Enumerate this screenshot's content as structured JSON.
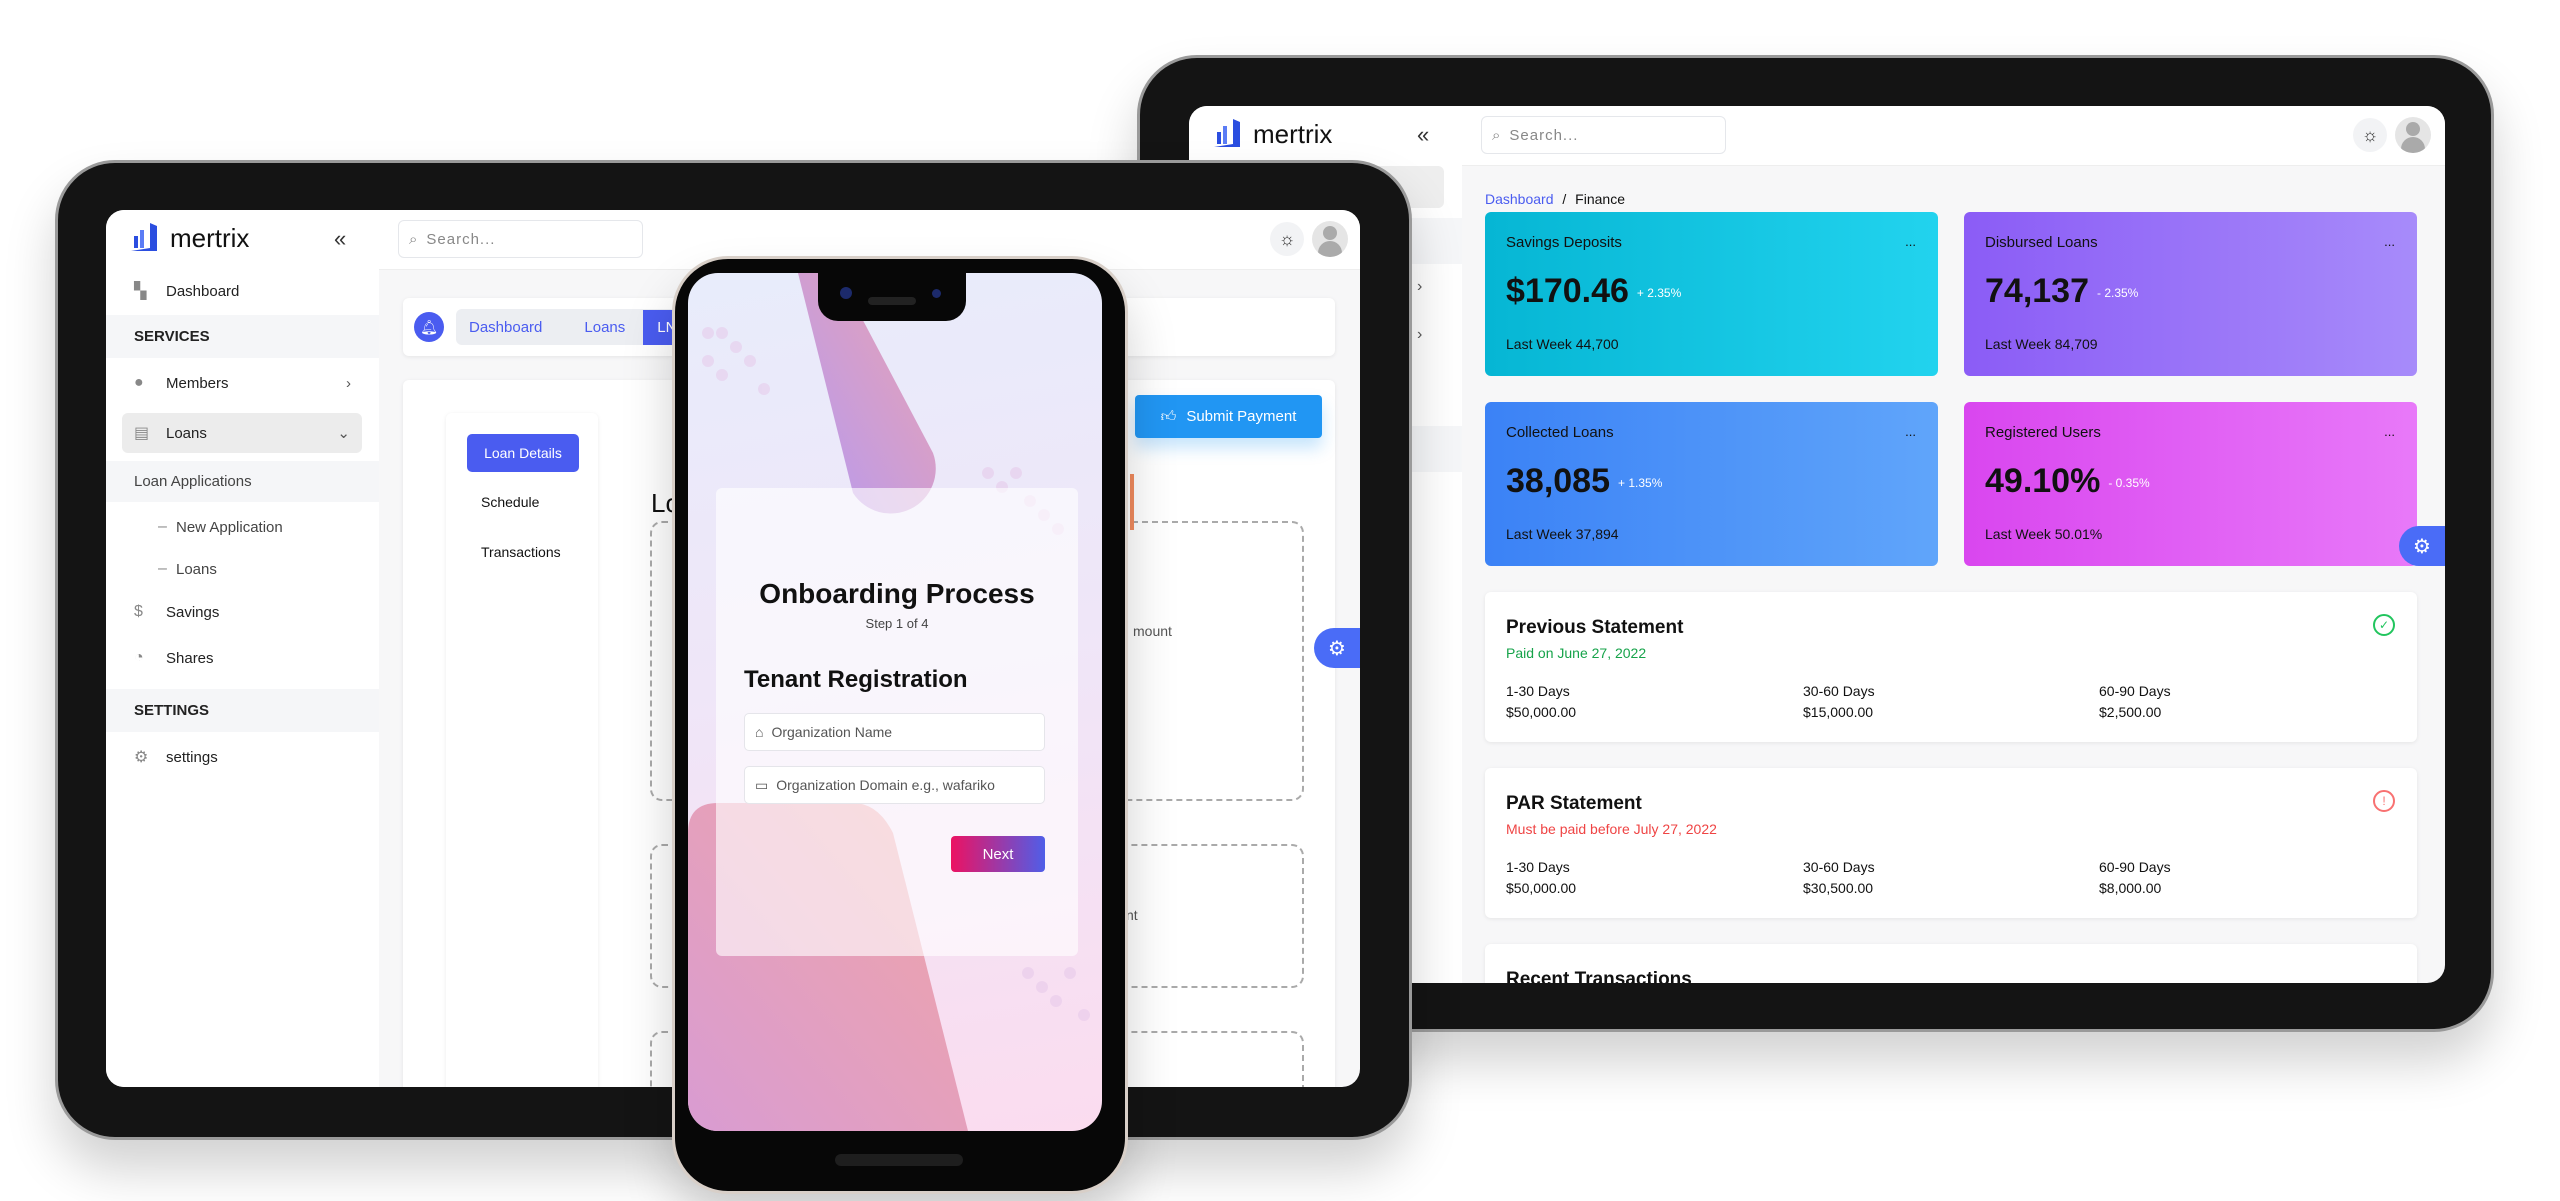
{
  "brand": "mertrix",
  "tablet_right": {
    "search_placeholder": "Search...",
    "breadcrumb": {
      "link": "Dashboard",
      "separator": "/",
      "current": "Finance"
    },
    "cards": [
      {
        "title": "Savings Deposits",
        "value": "$170.46",
        "change": "+ 2.35%",
        "last_week": "Last Week 44,700",
        "colors": [
          "#06b6d4",
          "#22d3ee"
        ]
      },
      {
        "title": "Disbursed Loans",
        "value": "74,137",
        "change": "- 2.35%",
        "last_week": "Last Week 84,709",
        "colors": [
          "#8b5cf6",
          "#a78bfa"
        ]
      },
      {
        "title": "Collected Loans",
        "value": "38,085",
        "change": "+ 1.35%",
        "last_week": "Last Week 37,894",
        "colors": [
          "#3b82f6",
          "#60a5fa"
        ]
      },
      {
        "title": "Registered Users",
        "value": "49.10%",
        "change": "- 0.35%",
        "last_week": "Last Week 50.01%",
        "colors": [
          "#d946ef",
          "#e879f9"
        ]
      }
    ],
    "more_label": "...",
    "statements": [
      {
        "title": "Previous Statement",
        "status": "Paid on June 27, 2022",
        "status_color": "#16a34a",
        "icon": "check-circle-icon",
        "cols": [
          {
            "label": "1-30 Days",
            "value": "$50,000.00"
          },
          {
            "label": "30-60 Days",
            "value": "$15,000.00"
          },
          {
            "label": "60-90 Days",
            "value": "$2,500.00"
          }
        ]
      },
      {
        "title": "PAR Statement",
        "status": "Must be paid before July 27, 2022",
        "status_color": "#ef4444",
        "icon": "alert-circle-icon",
        "cols": [
          {
            "label": "1-30 Days",
            "value": "$50,000.00"
          },
          {
            "label": "30-60 Days",
            "value": "$30,500.00"
          },
          {
            "label": "60-90 Days",
            "value": "$8,000.00"
          }
        ]
      }
    ],
    "recent_title": "Recent Transactions"
  },
  "tablet_left": {
    "search_placeholder": "Search...",
    "sidebar": {
      "dashboard": "Dashboard",
      "services": "Services",
      "members": "Members",
      "loans": "Loans",
      "loan_applications": "Loan Applications",
      "new_application": "New Application",
      "loans_sub": "Loans",
      "savings": "Savings",
      "shares": "Shares",
      "settings_header": "Settings",
      "settings": "settings"
    },
    "breadcrumb": [
      "Dashboard",
      "Loans",
      "LN"
    ],
    "tabs": [
      "Loan Details",
      "Schedule",
      "Transactions"
    ],
    "active_tab": "Loan Details",
    "submit_label": "Submit Payment",
    "heading_fragment": "Lo",
    "text_fragment_1": "mount",
    "text_fragment_2": "nt",
    "accent": "#4a5cf0"
  },
  "phone": {
    "title": "Onboarding Process",
    "step": "Step 1 of 4",
    "section": "Tenant Registration",
    "fields": [
      {
        "placeholder": "Organization Name",
        "icon": "home-icon"
      },
      {
        "placeholder": "Organization Domain e.g., wafariko",
        "icon": "laptop-icon"
      }
    ],
    "next_label": "Next"
  }
}
